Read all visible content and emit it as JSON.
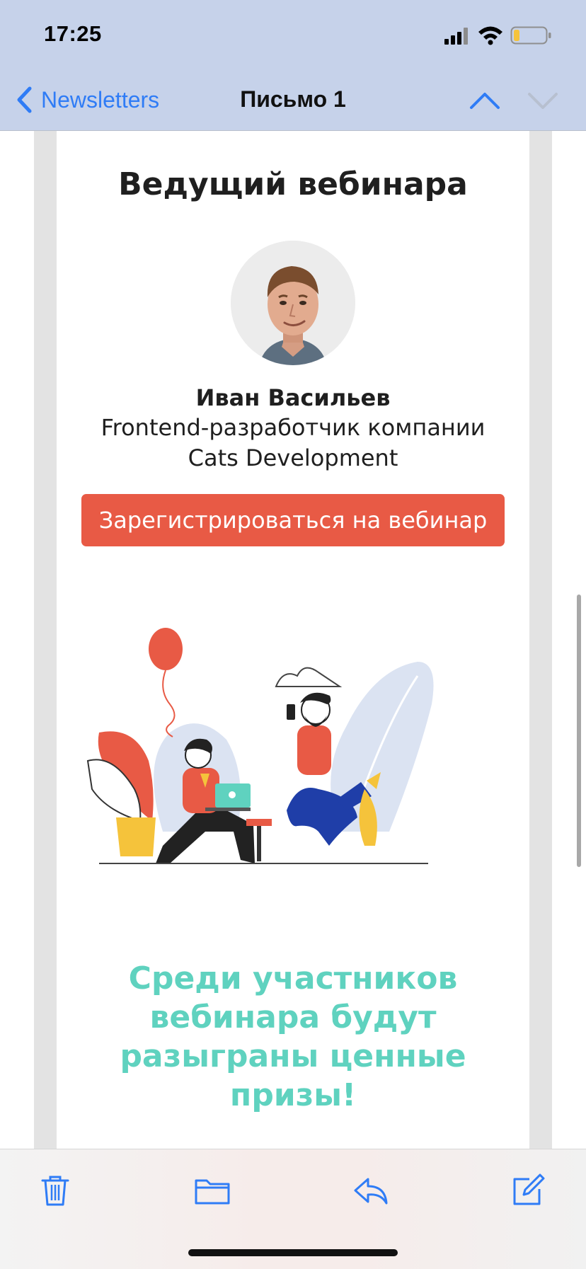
{
  "status_bar": {
    "time": "17:25",
    "icons": [
      "signal-icon",
      "wifi-icon",
      "battery-icon"
    ]
  },
  "nav": {
    "back_label": "Newsletters",
    "title": "Письмо 1",
    "icons": [
      "back-chevron-icon",
      "previous-message-icon",
      "next-message-icon"
    ]
  },
  "email": {
    "section_title": "Ведущий вебинара",
    "speaker": {
      "name": "Иван Васильев",
      "role_line1": "Frontend-разработчик компании",
      "role_line2": "Cats Development"
    },
    "register_button": "Зарегистрироваться на вебинар",
    "prize_lines": [
      "Среди участников",
      "вебинара будут",
      "разыграны ценные",
      "призы!"
    ]
  },
  "toolbar": {
    "icons": [
      "trash-icon",
      "folder-icon",
      "reply-icon",
      "compose-icon"
    ]
  },
  "colors": {
    "accent_blue": "#2f7cf6",
    "register_button": "#e85a45",
    "prize_text": "#5fd2bf",
    "header_bg": "#c6d2ea"
  }
}
